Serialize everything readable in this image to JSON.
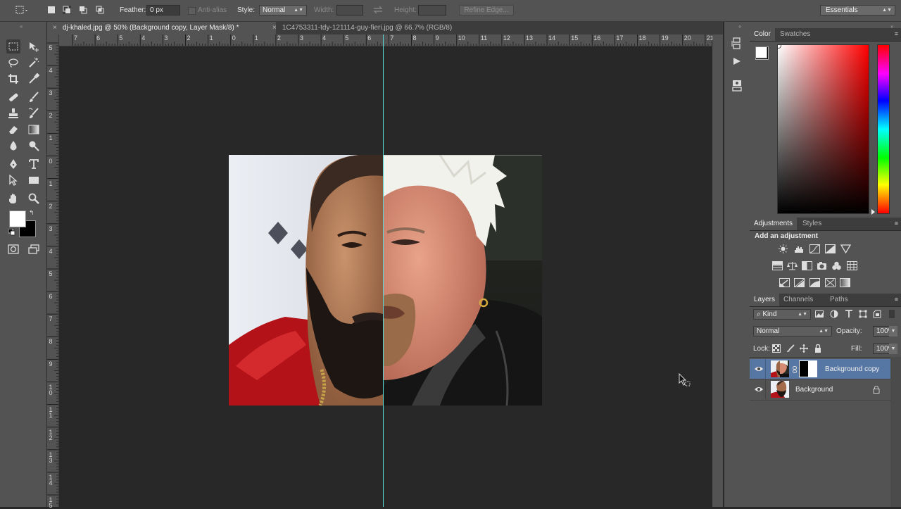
{
  "options_bar": {
    "feather_label": "Feather:",
    "feather_value": "0 px",
    "antialias_label": "Anti-alias",
    "style_label": "Style:",
    "style_value": "Normal",
    "width_label": "Width:",
    "height_label": "Height:",
    "refine_edge_label": "Refine Edge...",
    "workspace_value": "Essentials"
  },
  "tabs": [
    {
      "label": "dj-khaled.jpg @ 50% (Background copy, Layer Mask/8) *",
      "active": true
    },
    {
      "label": "1C4753311-tdy-121114-guy-fieri.jpg @ 66.7% (RGB/8)",
      "active": false
    }
  ],
  "ruler": {
    "h_ticks": [
      "7",
      "6",
      "5",
      "4",
      "3",
      "2",
      "1",
      "0",
      "1",
      "2",
      "3",
      "4",
      "5",
      "6",
      "7",
      "8",
      "9",
      "10",
      "11",
      "12",
      "13",
      "14",
      "15",
      "16",
      "17",
      "18",
      "19",
      "20",
      "21"
    ],
    "v_ticks": [
      "5",
      "4",
      "3",
      "2",
      "1",
      "0",
      "1",
      "2",
      "3",
      "4",
      "5",
      "6",
      "7",
      "8",
      "9",
      "10",
      "11",
      "12",
      "13",
      "14",
      "15"
    ]
  },
  "color_panel": {
    "tabs": [
      "Color",
      "Swatches"
    ],
    "foreground": "#ffffff",
    "background": "#000000"
  },
  "adjustments_panel": {
    "tabs": [
      "Adjustments",
      "Styles"
    ],
    "heading": "Add an adjustment"
  },
  "layers_panel": {
    "tabs": [
      "Layers",
      "Channels",
      "Paths"
    ],
    "filter_kind": "Kind",
    "blend_mode": "Normal",
    "opacity_label": "Opacity:",
    "opacity_value": "100%",
    "lock_label": "Lock:",
    "fill_label": "Fill:",
    "fill_value": "100%",
    "layers": [
      {
        "name": "Background copy",
        "selected": true,
        "has_mask": true
      },
      {
        "name": "Background",
        "selected": false,
        "locked": true
      }
    ]
  },
  "colors": {
    "ui_dark": "#535353",
    "canvas_bg": "#282828",
    "guide": "#59d6d6",
    "selection": "#5677a4"
  }
}
